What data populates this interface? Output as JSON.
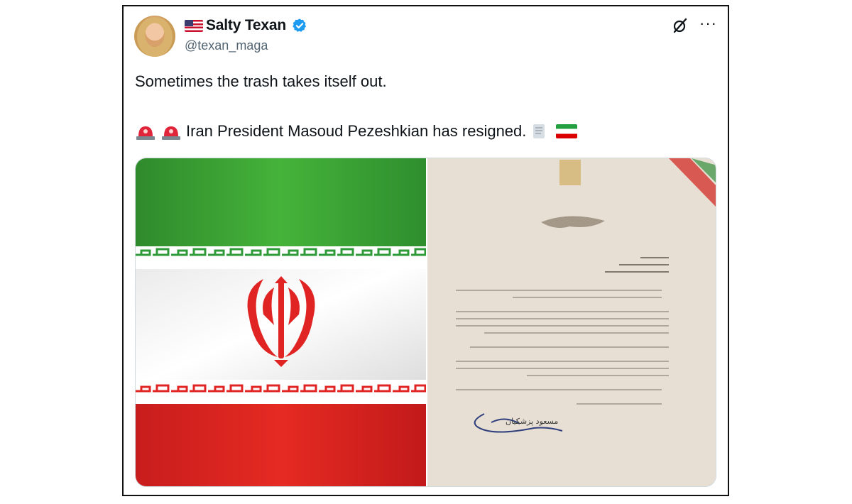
{
  "tweet": {
    "author": {
      "display_name": "Salty Texan",
      "handle": "@texan_maga",
      "verified": true,
      "flag_emoji": "us-flag-emoji"
    },
    "actions": {
      "grok_icon": "grok-icon",
      "more_icon": "more-icon",
      "more_label": "···"
    },
    "text": {
      "line1": "Sometimes the trash takes itself out.",
      "line2": "Iran President Masoud Pezeshkian has resigned."
    },
    "line2_emojis": {
      "before": [
        "police-light-emoji",
        "police-light-emoji"
      ],
      "after": [
        "scroll-emoji",
        "iran-flag-emoji"
      ]
    },
    "media": {
      "left_image": "iran-flag-image",
      "right_image": "resignation-letter-image",
      "letter_signature": "مسعود پزشکیان"
    }
  },
  "colors": {
    "text": "#0f1419",
    "secondary_text": "#536471",
    "verified_blue": "#1d9bf0",
    "iran_green": "#239f40",
    "iran_red": "#da0000"
  }
}
